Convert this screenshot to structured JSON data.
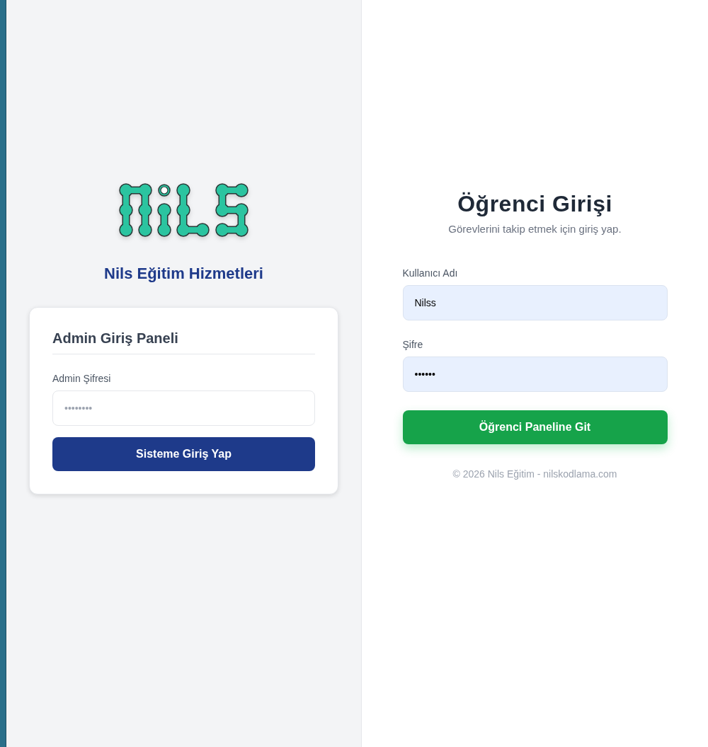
{
  "brand": {
    "title": "Nils Eğitim Hizmetleri"
  },
  "admin_panel": {
    "title": "Admin Giriş Paneli",
    "password_label": "Admin Şifresi",
    "password_placeholder": "••••••••",
    "button": "Sisteme Giriş Yap"
  },
  "student_login": {
    "title": "Öğrenci Girişi",
    "subtitle": "Görevlerini takip etmek için giriş yap.",
    "fields": [
      {
        "label": "Kullanıcı Adı",
        "value": "Nilss"
      },
      {
        "label": "Şifre",
        "value": "••••••"
      }
    ],
    "button": "Öğrenci Paneline Git"
  },
  "footer": "© 2026 Nils Eğitim - nilskodlama.com"
}
